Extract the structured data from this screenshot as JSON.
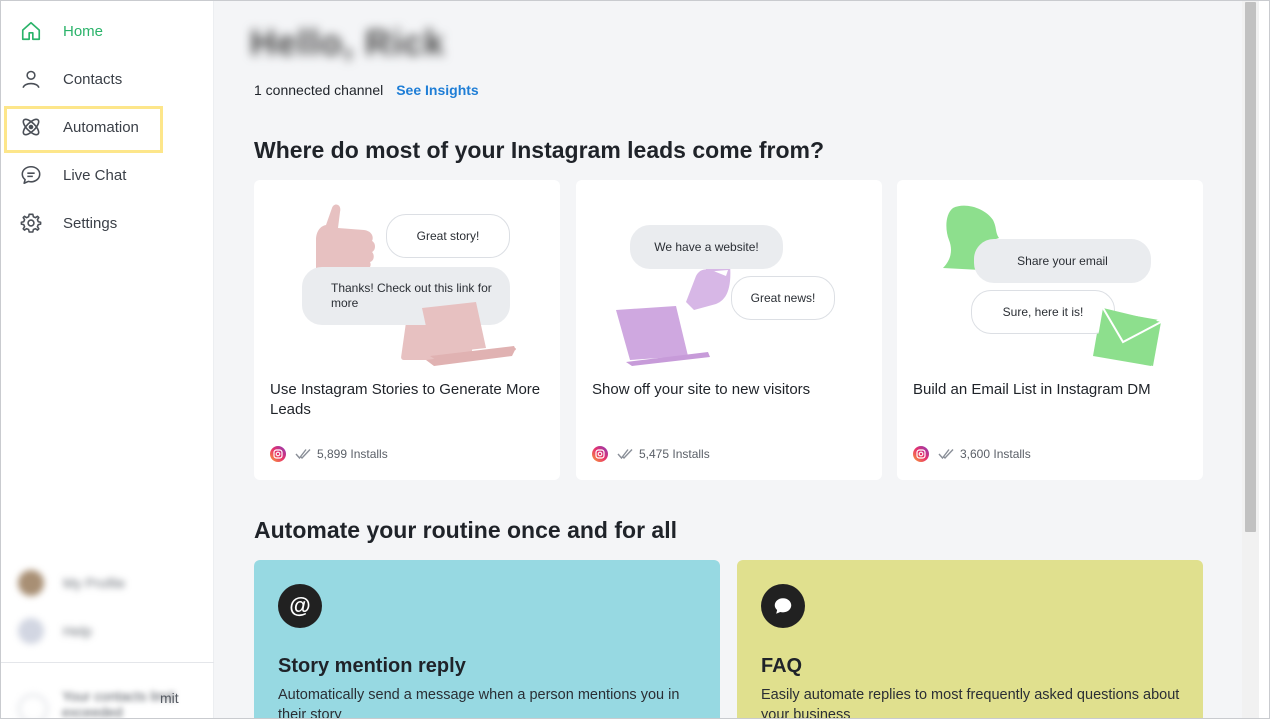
{
  "sidebar": {
    "items": [
      {
        "label": "Home",
        "icon": "home-icon",
        "active": true
      },
      {
        "label": "Contacts",
        "icon": "person-icon"
      },
      {
        "label": "Automation",
        "icon": "atom-icon"
      },
      {
        "label": "Live Chat",
        "icon": "chat-bubble-icon"
      },
      {
        "label": "Settings",
        "icon": "gear-icon"
      }
    ],
    "profile_label": "My Profile",
    "help_label": "Help",
    "trial_text_1": "Your contacts limit",
    "trial_suffix": "mit",
    "trial_text_2": "exceeded"
  },
  "header": {
    "greeting": "Hello, Rick",
    "channel_text": "1 connected channel",
    "insights_link": "See Insights"
  },
  "leads_section": {
    "title": "Where do most of your Instagram leads come from?",
    "cards": [
      {
        "title": "Use Instagram Stories to Generate More Leads",
        "installs": "5,899 Installs",
        "bubble_1": "Great story!",
        "bubble_2": "Thanks! Check out this link for more"
      },
      {
        "title": "Show off your site to new visitors",
        "installs": "5,475 Installs",
        "bubble_1": "We have a website!",
        "bubble_2": "Great news!"
      },
      {
        "title": "Build an Email List in Instagram DM",
        "installs": "3,600 Installs",
        "bubble_1": "Share your email",
        "bubble_2": "Sure, here it is!"
      }
    ]
  },
  "automate_section": {
    "title": "Automate your routine once and for all",
    "tiles": [
      {
        "icon_glyph": "@",
        "title": "Story mention reply",
        "desc": "Automatically send a message when a person mentions you in their story"
      },
      {
        "icon_glyph": "",
        "title": "FAQ",
        "desc": "Easily automate replies to most frequently asked questions about your business"
      }
    ]
  },
  "colors": {
    "accent_green": "#2bb36a",
    "link_blue": "#1f7ed6",
    "highlight_yellow": "#fde68a",
    "tile_cyan": "#97d9e2",
    "tile_yellow": "#e0e08e"
  }
}
